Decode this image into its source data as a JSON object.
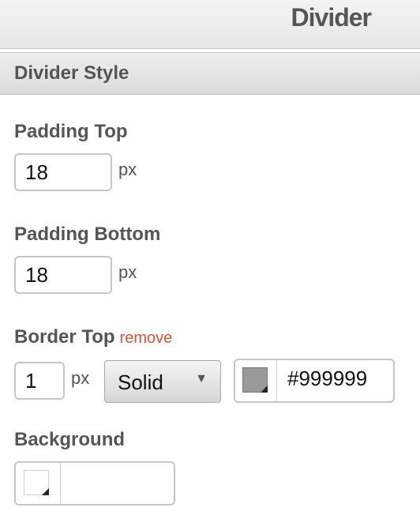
{
  "header": {
    "title": "Divider"
  },
  "section": {
    "title": "Divider Style"
  },
  "padding_top": {
    "label": "Padding Top",
    "value": "18",
    "unit": "px"
  },
  "padding_bottom": {
    "label": "Padding Bottom",
    "value": "18",
    "unit": "px"
  },
  "border_top": {
    "label": "Border Top",
    "remove_label": "remove",
    "width_value": "1",
    "unit": "px",
    "style_value": "Solid",
    "color_value": "#999999",
    "swatch_color": "#999999"
  },
  "background": {
    "label": "Background",
    "color_value": "",
    "swatch_color": "#ffffff"
  },
  "icons": {
    "dropdown": "triangle-down-icon",
    "swatch_corner": "corner-triangle-icon"
  },
  "colors": {
    "remove_link": "#d9533b",
    "label_text": "#555555"
  }
}
